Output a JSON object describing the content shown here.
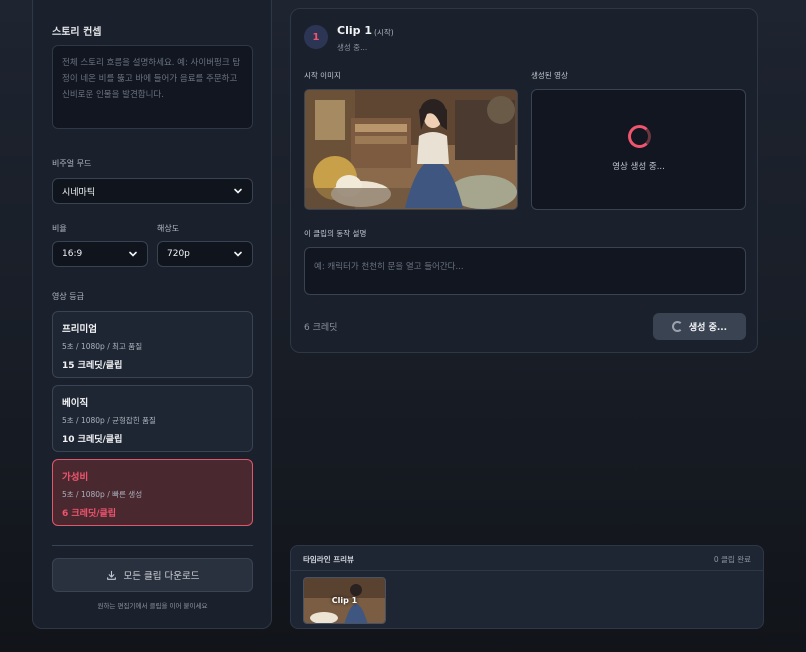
{
  "sidebar": {
    "story_concept_title": "스토리 컨셉",
    "story_placeholder": "전체 스토리 흐름을 설명하세요. 예: 사이버펑크 탐정이 네온 비를 뚫고 바에 들어가 음료를 주문하고 신비로운 인물을 발견합니다.",
    "visual_mood_label": "비주얼 무드",
    "visual_mood_value": "시네마틱",
    "ratio_label": "비율",
    "ratio_value": "16:9",
    "resolution_label": "해상도",
    "resolution_value": "720p",
    "grade_label": "영상 등급",
    "grades": [
      {
        "name": "프리미엄",
        "desc": "5초 / 1080p / 최고 품질",
        "credits": "15 크레딧/클립",
        "active": false
      },
      {
        "name": "베이직",
        "desc": "5초 / 1080p / 균형잡힌 품질",
        "credits": "10 크레딧/클립",
        "active": false
      },
      {
        "name": "가성비",
        "desc": "5초 / 1080p / 빠른 생성",
        "credits": "6 크레딧/클립",
        "active": true
      }
    ],
    "download_label": "모든 클립 다운로드",
    "footnote": "원하는 편집기에서 클립을 이어 붙이세요"
  },
  "clip": {
    "number": "1",
    "title": "Clip 1",
    "subtitle": "(시작)",
    "status": "생성 중...",
    "start_image_label": "시작 이미지",
    "generated_video_label": "생성된 영상",
    "generating_text": "영상 생성 중...",
    "motion_label": "이 클립의 동작 설명",
    "motion_placeholder": "예: 캐릭터가 천천히 문을 열고 들어간다...",
    "credit_text": "6 크레딧",
    "generate_button": "생성 중..."
  },
  "timeline": {
    "title": "타임라인 프리뷰",
    "count": "0 클립 완료",
    "thumb_label": "Clip 1"
  },
  "colors": {
    "accent": "#f0556d",
    "background": "#1b212c"
  }
}
